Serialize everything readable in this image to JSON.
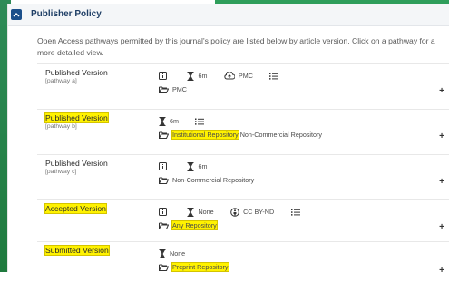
{
  "header": {
    "title": "Publisher Policy"
  },
  "intro": {
    "text": "Open Access pathways permitted by this journal's policy are listed below by article version. Click on a pathway for a more detailed view."
  },
  "rows": [
    {
      "version": "Published Version",
      "pathway": "[pathway a]",
      "embargo": "6m",
      "deposit": "PMC",
      "locations": [
        "PMC"
      ],
      "highlight": false
    },
    {
      "version": "Published Version",
      "pathway": "[pathway b]",
      "embargo": "6m",
      "locations": [
        "Institutional Repository",
        "Non-Commercial Repository"
      ],
      "highlight": true
    },
    {
      "version": "Published Version",
      "pathway": "[pathway c]",
      "embargo": "6m",
      "locations": [
        "Non-Commercial Repository"
      ],
      "highlight": false
    },
    {
      "version": "Accepted Version",
      "embargo": "None",
      "license": "CC BY-ND",
      "locations": [
        "Any Repository"
      ],
      "highlight": true
    },
    {
      "version": "Submitted Version",
      "embargo": "None",
      "locations": [
        "Preprint Repository"
      ],
      "highlight": true
    }
  ],
  "expand_symbol": "+",
  "colors": {
    "accent": "#1b4f8a",
    "highlight": "#fff200",
    "green": "#2f9e5b"
  },
  "icons": {
    "toggle": "chevron-up-icon",
    "info": "info-icon",
    "embargo": "hourglass-icon",
    "deposit": "cloud-upload-icon",
    "license": "cc-license-icon",
    "conditions": "list-icon",
    "location": "folder-open-icon"
  }
}
